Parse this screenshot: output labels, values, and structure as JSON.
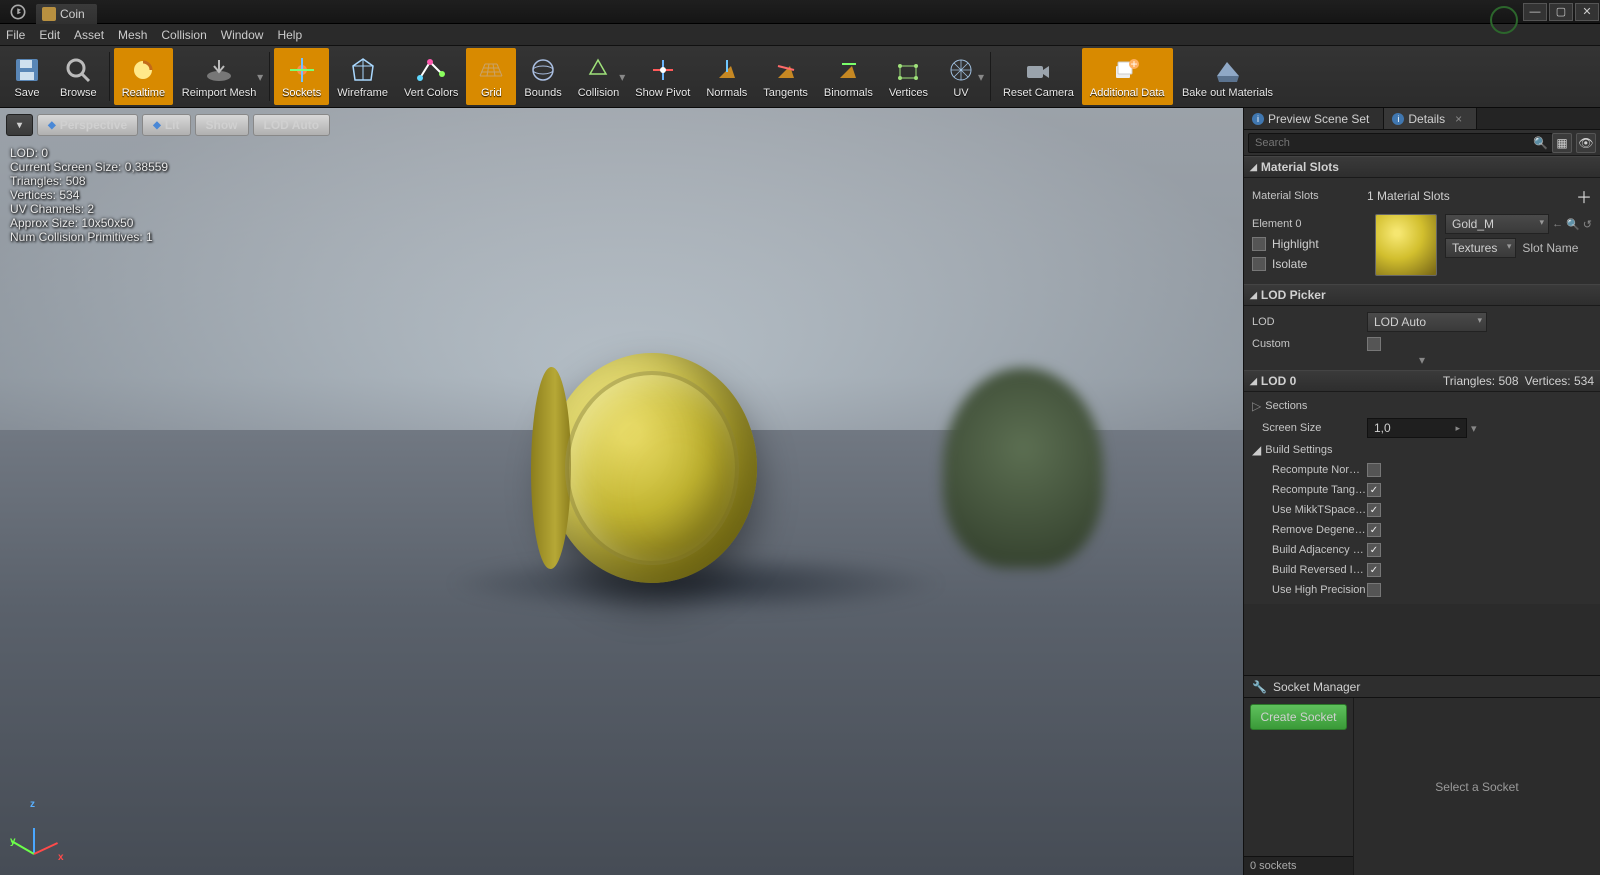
{
  "title": {
    "tab_label": "Coin"
  },
  "menu": [
    "File",
    "Edit",
    "Asset",
    "Mesh",
    "Collision",
    "Window",
    "Help"
  ],
  "toolbar": {
    "save": "Save",
    "browse": "Browse",
    "realtime": "Realtime",
    "reimport": "Reimport Mesh",
    "sockets": "Sockets",
    "wireframe": "Wireframe",
    "vertcolors": "Vert Colors",
    "grid": "Grid",
    "bounds": "Bounds",
    "collision": "Collision",
    "showpivot": "Show Pivot",
    "normals": "Normals",
    "tangents": "Tangents",
    "binormals": "Binormals",
    "vertices": "Vertices",
    "uv": "UV",
    "resetcam": "Reset Camera",
    "adddata": "Additional Data",
    "bakemat": "Bake out Materials"
  },
  "viewport": {
    "dropdown": "▾",
    "perspective": "Perspective",
    "lit": "Lit",
    "show": "Show",
    "lod_auto": "LOD Auto",
    "stats": {
      "lod": "LOD:  0",
      "screen_size": "Current Screen Size:  0,38559",
      "triangles": "Triangles:  508",
      "vertices": "Vertices:  534",
      "uv": "UV Channels:  2",
      "approx": "Approx Size:  10x50x50",
      "collision": "Num Collision Primitives:  1"
    },
    "axes": {
      "x": "x",
      "y": "y",
      "z": "z"
    }
  },
  "tabs": {
    "preview": "Preview Scene Set",
    "details": "Details"
  },
  "search": {
    "placeholder": "Search"
  },
  "details": {
    "material_slots": {
      "header": "Material Slots",
      "row_label": "Material Slots",
      "row_value": "1 Material Slots",
      "element0": "Element 0",
      "highlight": "Highlight",
      "isolate": "Isolate",
      "mat_name": "Gold_M",
      "textures": "Textures",
      "slot_name": "Slot Name"
    },
    "lod_picker": {
      "header": "LOD Picker",
      "lod": "LOD",
      "lod_value": "LOD Auto",
      "custom": "Custom"
    },
    "lod0": {
      "header": "LOD 0",
      "triangles": "Triangles: 508",
      "vertices": "Vertices: 534",
      "sections": "Sections",
      "screen_size": "Screen Size",
      "screen_size_val": "1,0",
      "build_settings": "Build Settings",
      "recompute_normals": "Recompute Normals",
      "recompute_tangents": "Recompute Tangents",
      "mikktspace": "Use MikkTSpace Tangent",
      "remove_degen": "Remove Degenerates",
      "adjacency": "Build Adjacency Buffer",
      "reversed": "Build Reversed Index",
      "highprec": "Use High Precision"
    }
  },
  "socket": {
    "header": "Socket Manager",
    "create": "Create Socket",
    "empty": "Select a Socket",
    "count": "0 sockets"
  }
}
